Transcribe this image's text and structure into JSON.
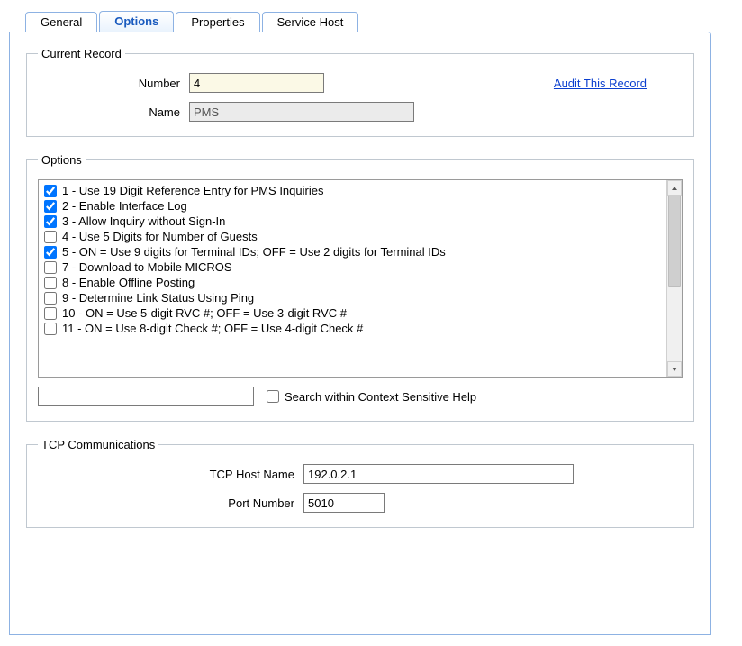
{
  "tabs": {
    "general": "General",
    "options": "Options",
    "properties": "Properties",
    "service_host": "Service Host"
  },
  "current_record": {
    "legend": "Current Record",
    "number_label": "Number",
    "number_value": "4",
    "name_label": "Name",
    "name_value": "PMS",
    "audit_link": "Audit This Record"
  },
  "options_group": {
    "legend": "Options",
    "items": [
      {
        "id": 1,
        "checked": true,
        "label": "1 - Use 19 Digit Reference Entry for PMS Inquiries"
      },
      {
        "id": 2,
        "checked": true,
        "label": "2 - Enable Interface Log"
      },
      {
        "id": 3,
        "checked": true,
        "label": "3 - Allow Inquiry without Sign-In"
      },
      {
        "id": 4,
        "checked": false,
        "label": "4 - Use 5 Digits for Number of Guests"
      },
      {
        "id": 5,
        "checked": true,
        "label": "5 - ON = Use 9 digits for Terminal IDs; OFF = Use 2 digits for Terminal IDs"
      },
      {
        "id": 7,
        "checked": false,
        "label": "7 - Download to Mobile MICROS"
      },
      {
        "id": 8,
        "checked": false,
        "label": "8 - Enable Offline Posting"
      },
      {
        "id": 9,
        "checked": false,
        "label": "9 - Determine Link Status Using Ping"
      },
      {
        "id": 10,
        "checked": false,
        "label": "10 - ON = Use 5-digit RVC #; OFF = Use 3-digit RVC #"
      },
      {
        "id": 11,
        "checked": false,
        "label": "11 - ON = Use 8-digit Check #; OFF = Use 4-digit Check #"
      }
    ],
    "search_checkbox_label": "Search within Context Sensitive Help",
    "search_value": ""
  },
  "tcp": {
    "legend": "TCP Communications",
    "host_label": "TCP Host Name",
    "host_value": "192.0.2.1",
    "port_label": "Port Number",
    "port_value": "5010"
  }
}
